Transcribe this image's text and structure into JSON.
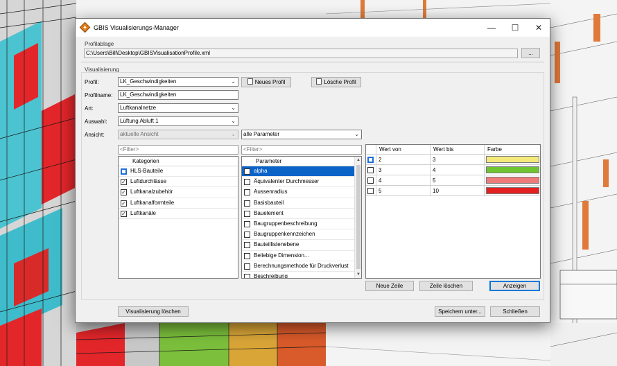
{
  "window": {
    "title": "GBIS Visualisierungs-Manager",
    "minimize": "—",
    "maximize": "☐",
    "close": "✕"
  },
  "profilablage": {
    "label": "Profilablage",
    "path": "C:\\Users\\Bill\\Desktop\\GBISVisualisationProfile.xml",
    "browse_label": "..."
  },
  "visualisierung": {
    "label": "Visualisierung",
    "profil_label": "Profil:",
    "profil_value": "LK_Geschwindigkeiten",
    "neues_profil_label": "Neues Profil",
    "loesche_profil_label": "Lösche Profil",
    "profilname_label": "Profilname:",
    "profilname_value": "LK_Geschwindigkeiten",
    "art_label": "Art:",
    "art_value": "Luftkanalnetze",
    "auswahl_label": "Auswahl:",
    "auswahl_value": "Lüftung Abluft 1",
    "ansicht_label": "Ansicht:",
    "ansicht_value": "aktuelle Ansicht",
    "parameter_filter_value": "alle Parameter"
  },
  "kategorien": {
    "filter_placeholder": "<Filter>",
    "header": "Kategorien",
    "items": [
      {
        "label": "HLS-Bauteile",
        "checked": false
      },
      {
        "label": "Luftdurchlässe",
        "checked": true
      },
      {
        "label": "Luftkanalzubehör",
        "checked": true
      },
      {
        "label": "Luftkanalformteile",
        "checked": true
      },
      {
        "label": "Luftkanäle",
        "checked": true
      }
    ]
  },
  "parameter": {
    "filter_placeholder": "<Filter>",
    "header": "Parameter",
    "items": [
      {
        "label": "alpha",
        "checked": false,
        "selected": true
      },
      {
        "label": "Äquivalenter Durchmesser",
        "checked": false
      },
      {
        "label": "Aussenradius",
        "checked": false
      },
      {
        "label": "Basisbauteil",
        "checked": false
      },
      {
        "label": "Bauelement",
        "checked": false
      },
      {
        "label": "Baugruppenbeschreibung",
        "checked": false
      },
      {
        "label": "Baugruppenkennzeichen",
        "checked": false
      },
      {
        "label": "Bauteillistenebene",
        "checked": false
      },
      {
        "label": "Beliebige Dimension...",
        "checked": false
      },
      {
        "label": "Berechnungsmethode für Druckverlust",
        "checked": false
      },
      {
        "label": "Beschreibung",
        "checked": false
      }
    ]
  },
  "werte": {
    "headers": {
      "von": "Wert von",
      "bis": "Wert bis",
      "farbe": "Farbe"
    },
    "rows": [
      {
        "von": "2",
        "bis": "3",
        "farbe": "#f3ea7a"
      },
      {
        "von": "3",
        "bis": "4",
        "farbe": "#6fc431"
      },
      {
        "von": "4",
        "bis": "5",
        "farbe": "#ef7a7a"
      },
      {
        "von": "5",
        "bis": "10",
        "farbe": "#e52020"
      }
    ]
  },
  "buttons": {
    "neue_zeile": "Neue Zeile",
    "zeile_loeschen": "Zeile löschen",
    "anzeigen": "Anzeigen",
    "visualisierung_loeschen": "Visualisierung löschen",
    "speichern_unter": "Speichern unter...",
    "schliessen": "Schließen"
  }
}
